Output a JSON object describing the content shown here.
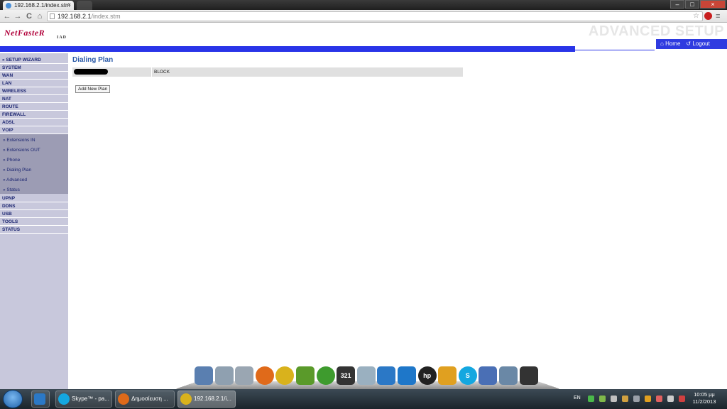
{
  "browser": {
    "tab_title": "192.168.2.1/index.stm",
    "tab_close": "×",
    "url_host": "192.168.2.1",
    "url_path": "/index.stm",
    "back": "←",
    "forward": "→",
    "reload": "C",
    "home": "⌂",
    "star": "☆",
    "window_min": "–",
    "window_max": "□",
    "window_close": "×"
  },
  "router": {
    "logo_main": "NetFasteR",
    "logo_sub": "IAD",
    "header_title": "ADVANCED SETUP",
    "topnav": {
      "home": "Home",
      "logout": "Logout"
    },
    "menu": [
      "» SETUP WIZARD",
      "SYSTEM",
      "WAN",
      "LAN",
      "WIRELESS",
      "NAT",
      "ROUTE",
      "FIREWALL",
      "ADSL",
      "VOIP"
    ],
    "voip_submenu": [
      "» Extensions IN",
      "» Extensions OUT",
      "» Phone",
      "» Dialing Plan",
      "» Advanced",
      "» Status"
    ],
    "menu_after": [
      "UPnP",
      "DDNS",
      "USB",
      "TOOLS",
      "STATUS"
    ],
    "content": {
      "title": "Dialing Plan",
      "plan_action": "BLOCK",
      "add_button": "Add New Plan"
    }
  },
  "dock": {
    "icons": [
      {
        "name": "computer-icon",
        "color": "#5a7fb0"
      },
      {
        "name": "recycle-bin-icon",
        "color": "#8fa0b0"
      },
      {
        "name": "finder-icon",
        "color": "#9aa6b2"
      },
      {
        "name": "firefox-icon",
        "color": "#e06a1a"
      },
      {
        "name": "chrome-icon",
        "color": "#d9b21c"
      },
      {
        "name": "app-icon",
        "color": "#5a9a2a"
      },
      {
        "name": "utorrent-icon",
        "color": "#3e9b2e"
      },
      {
        "name": "media-player-icon",
        "color": "#333333"
      },
      {
        "name": "calculator-icon",
        "color": "#9ab0c0"
      },
      {
        "name": "skydrive-icon",
        "color": "#2b78c6"
      },
      {
        "name": "teamviewer-icon",
        "color": "#1e77c9"
      },
      {
        "name": "hp-icon",
        "color": "#222222"
      },
      {
        "name": "folder-icon",
        "color": "#e0a020"
      },
      {
        "name": "skype-icon",
        "color": "#14a7e0"
      },
      {
        "name": "flash-icon",
        "color": "#4a6fb5"
      },
      {
        "name": "dolphin-icon",
        "color": "#6a88a6"
      },
      {
        "name": "monitor-icon",
        "color": "#333333"
      }
    ],
    "media_player_label": "321",
    "hp_label": "hp",
    "skype_label": "S"
  },
  "taskbar": {
    "items": [
      {
        "label": "Skype™ - pa...",
        "color": "#14a7e0"
      },
      {
        "label": "Δημοσίευση ...",
        "color": "#e06a1a"
      },
      {
        "label": "192.168.2.1/i...",
        "color": "#d9b21c"
      }
    ],
    "lang": "EN",
    "time": "10:05 μμ",
    "date": "11/2/2013"
  }
}
